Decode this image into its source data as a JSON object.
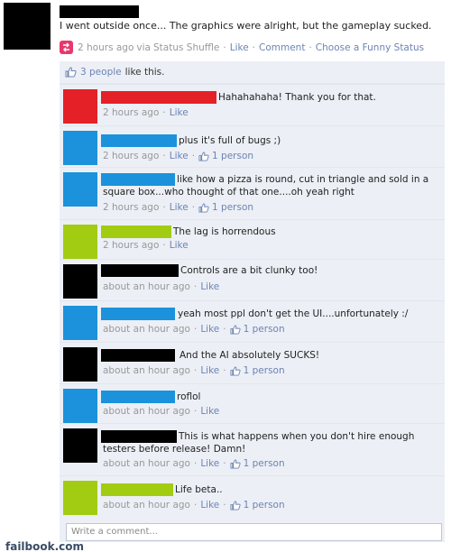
{
  "post": {
    "text": "I went outside once... The graphics were alright, but the gameplay sucked.",
    "time": "2 hours ago",
    "via": "via",
    "app_name": "Status Shuffle",
    "actions": [
      "Like",
      "Comment",
      "Choose a Funny Status"
    ]
  },
  "likes": {
    "count_text": "3 people",
    "suffix": "like this."
  },
  "comments": [
    {
      "text": "Hahahahaha! Thank you for that.",
      "time": "2 hours ago",
      "like": "Like",
      "likes": "",
      "avatar_color": "#e42127"
    },
    {
      "text": "plus it's full of bugs ;)",
      "time": "2 hours ago",
      "like": "Like",
      "likes": "1 person",
      "avatar_color": "#1b92db"
    },
    {
      "text": "like how a pizza is round, cut in triangle and sold in a square box...who thought of that one....oh yeah right",
      "time": "2 hours ago",
      "like": "Like",
      "likes": "1 person",
      "avatar_color": "#1b92db"
    },
    {
      "text": "The lag is horrendous",
      "time": "2 hours ago",
      "like": "Like",
      "likes": "",
      "avatar_color": "#a2cc12"
    },
    {
      "text": "Controls are a bit clunky too!",
      "time": "about an hour ago",
      "like": "Like",
      "likes": "",
      "avatar_color": "#000000"
    },
    {
      "text": "yeah most ppl don't get the UI....unfortunately :/",
      "time": "about an hour ago",
      "like": "Like",
      "likes": "1 person",
      "avatar_color": "#1b92db"
    },
    {
      "text": "And the AI absolutely SUCKS!",
      "time": "about an hour ago",
      "like": "Like",
      "likes": "1 person",
      "avatar_color": "#000000"
    },
    {
      "text": "roflol",
      "time": "about an hour ago",
      "like": "Like",
      "likes": "",
      "avatar_color": "#1b92db"
    },
    {
      "text": "This is what happens when you don't hire enough testers before release! Damn!",
      "time": "about an hour ago",
      "like": "Like",
      "likes": "1 person",
      "avatar_color": "#000000"
    },
    {
      "text": "Life beta..",
      "time": "about an hour ago",
      "like": "Like",
      "likes": "1 person",
      "avatar_color": "#a2cc12"
    }
  ],
  "write_comment": {
    "placeholder": "Write a comment..."
  },
  "watermark": "failbook.com",
  "colors": {
    "link": "#6d84b4",
    "feedback_bg": "#eceff5",
    "meta": "#999999"
  }
}
